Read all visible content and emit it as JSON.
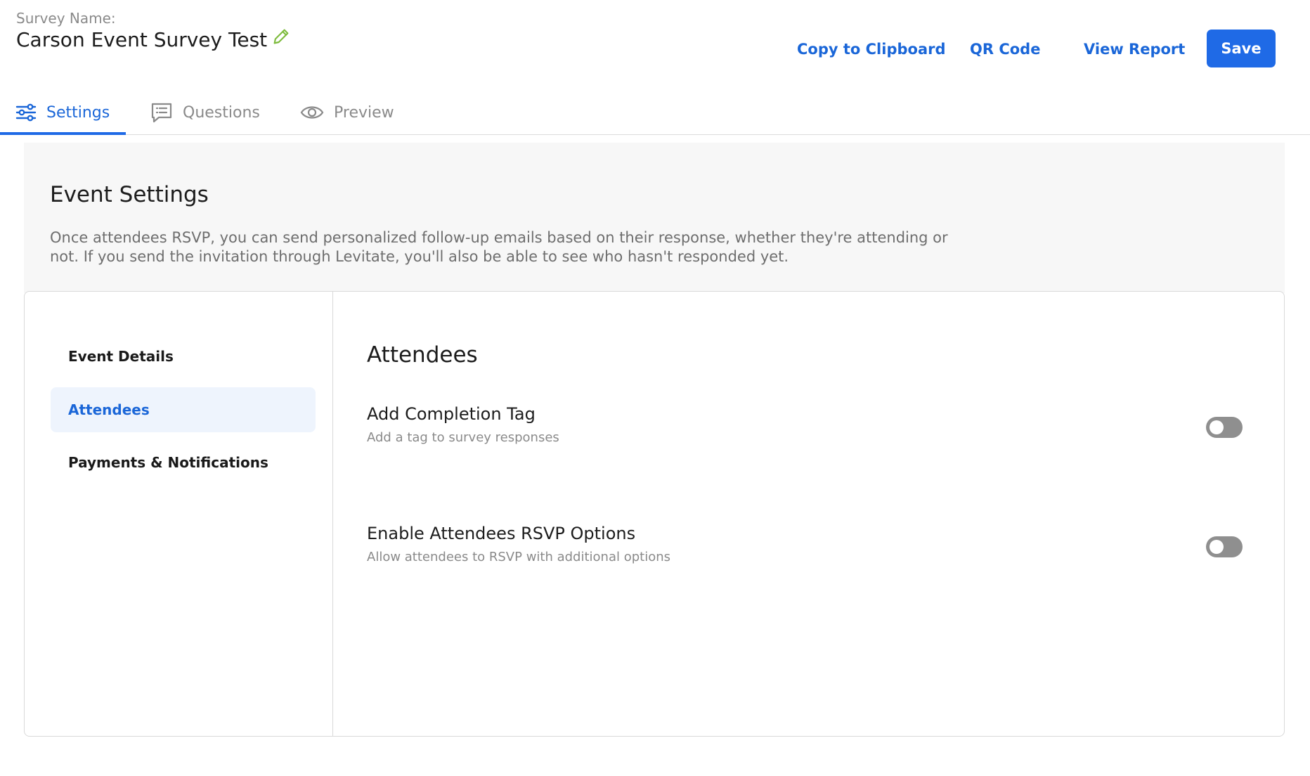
{
  "header": {
    "survey_label": "Survey Name:",
    "survey_title": "Carson Event Survey Test",
    "edit_icon": "pencil-icon",
    "actions": {
      "copy_label": "Copy to Clipboard",
      "qr_label": "QR Code",
      "report_label": "View Report",
      "save_label": "Save"
    }
  },
  "tabs": [
    {
      "label": "Settings",
      "icon": "sliders-icon",
      "active": true
    },
    {
      "label": "Questions",
      "icon": "chat-list-icon",
      "active": false
    },
    {
      "label": "Preview",
      "icon": "eye-icon",
      "active": false
    }
  ],
  "settings": {
    "title": "Event Settings",
    "description": "Once attendees RSVP, you can send personalized follow-up emails based on their response, whether they're attending or not. If you send the invitation through Levitate, you'll also be able to see who hasn't responded yet."
  },
  "sidebar": {
    "items": [
      {
        "label": "Event Details",
        "active": false
      },
      {
        "label": "Attendees",
        "active": true
      },
      {
        "label": "Payments & Notifications",
        "active": false
      }
    ]
  },
  "attendees": {
    "title": "Attendees",
    "options": [
      {
        "title": "Add Completion Tag",
        "subtitle": "Add a tag to survey responses",
        "enabled": false
      },
      {
        "title": "Enable Attendees RSVP Options",
        "subtitle": "Allow attendees to RSVP with additional options",
        "enabled": false
      }
    ]
  },
  "colors": {
    "accent": "#1f6ae6",
    "link": "#1a66d8",
    "edit_icon": "#7dbb3c",
    "toggle_off": "#8f8f8f"
  }
}
